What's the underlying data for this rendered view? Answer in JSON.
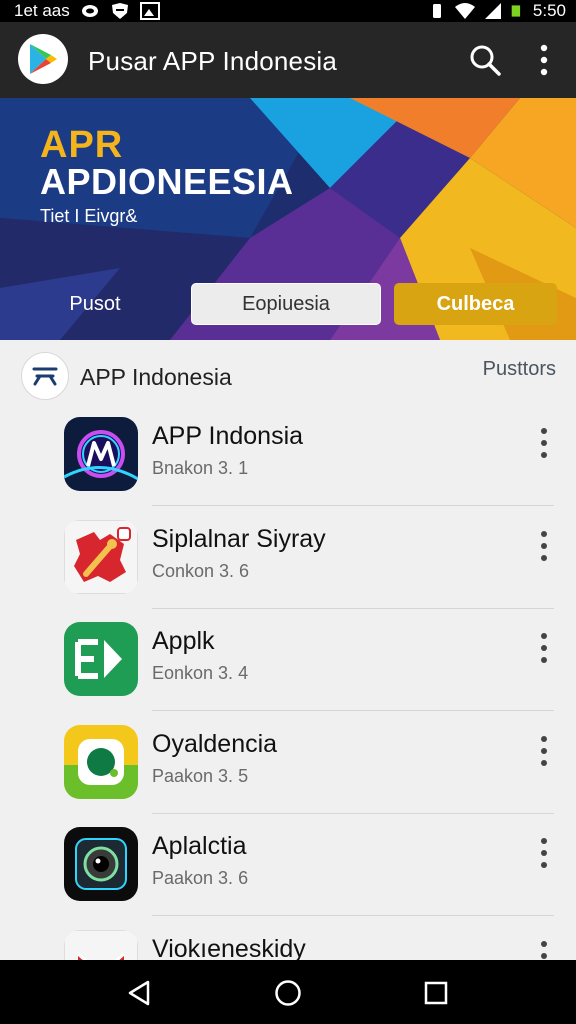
{
  "status_bar": {
    "left_text": "1et aas",
    "time": "5:50"
  },
  "app_bar": {
    "title": "Pusar APP Indonesia",
    "icons": [
      "play-store-logo",
      "search-icon",
      "more-vert-icon"
    ]
  },
  "banner": {
    "title_line1": "APR",
    "title_line2": "APDIONEESIA",
    "subtitle": "Tiet I Eivgr&",
    "tabs": [
      {
        "label": "Pusot"
      },
      {
        "label": "Eopiuesia"
      },
      {
        "label": "Culbeca"
      }
    ],
    "colors": {
      "accent_yellow": "#f4b41c",
      "tab_gold": "#d9a411"
    }
  },
  "section": {
    "title": "APP Indonesia",
    "link_label": "Pusttors"
  },
  "apps": [
    {
      "name": "APP Indonsia",
      "meta": "Bnakon 3. 1",
      "icon": "neon-m-icon"
    },
    {
      "name": "Siplalnar Siyray",
      "meta": "Conkon 3. 6",
      "icon": "puzzle-icon"
    },
    {
      "name": "Applk",
      "meta": "Eonkon 3. 4",
      "icon": "ek-arrow-icon"
    },
    {
      "name": "Oyaldencia",
      "meta": "Paakon 3. 5",
      "icon": "green-circle-icon"
    },
    {
      "name": "Aplalctia",
      "meta": "Paakon 3. 6",
      "icon": "camera-lens-icon"
    },
    {
      "name": "Viokıeneskidy",
      "meta": "",
      "icon": "mail-icon"
    }
  ],
  "nav_bar": {
    "icons": [
      "back-icon",
      "home-icon",
      "recents-icon"
    ]
  }
}
